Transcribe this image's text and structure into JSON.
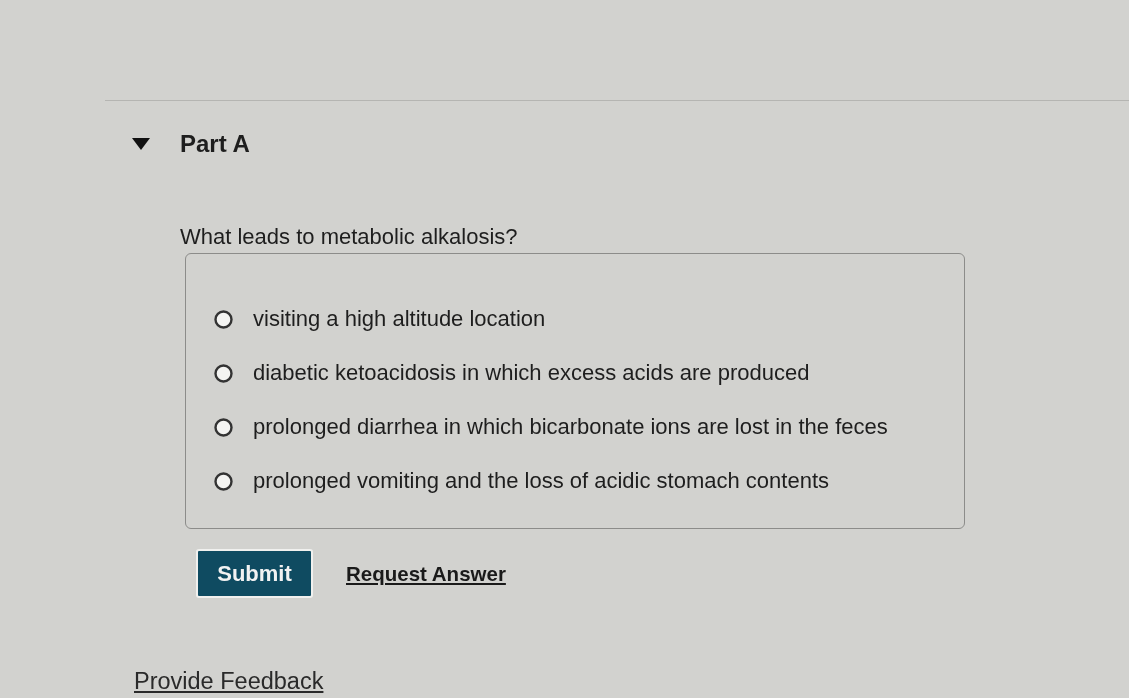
{
  "part": {
    "title": "Part A",
    "expanded": true
  },
  "question": "What leads to metabolic alkalosis?",
  "options": [
    {
      "label": "visiting a high altitude location",
      "selected": false
    },
    {
      "label": "diabetic ketoacidosis in which excess acids are produced",
      "selected": false
    },
    {
      "label": "prolonged diarrhea in which bicarbonate ions are lost in the feces",
      "selected": false
    },
    {
      "label": "prolonged vomiting and the loss of acidic stomach contents",
      "selected": false
    }
  ],
  "actions": {
    "submit": "Submit",
    "request_answer": "Request Answer"
  },
  "feedback_link": "Provide Feedback"
}
